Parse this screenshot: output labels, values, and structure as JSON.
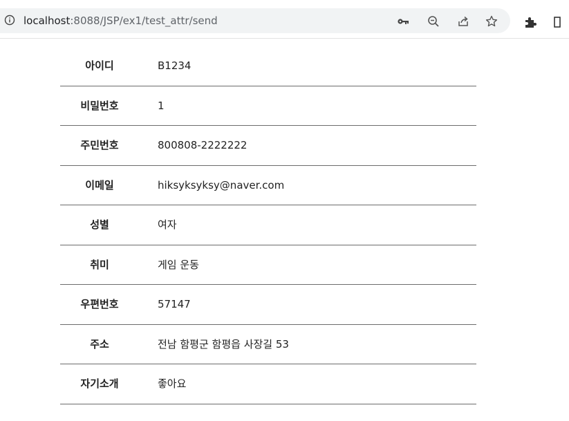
{
  "browser": {
    "url_host": "localhost",
    "url_path": ":8088/JSP/ex1/test_attr/send",
    "icons": [
      "info-icon",
      "key-icon",
      "zoom-icon",
      "share-icon",
      "star-icon",
      "extensions-icon"
    ]
  },
  "fields": [
    {
      "label": "아이디",
      "value": "B1234"
    },
    {
      "label": "비밀번호",
      "value": "1"
    },
    {
      "label": "주민번호",
      "value": "800808-2222222"
    },
    {
      "label": "이메일",
      "value": "hiksyksyksy@naver.com"
    },
    {
      "label": "성별",
      "value": "여자"
    },
    {
      "label": "취미",
      "value": "게임 운동"
    },
    {
      "label": "우편번호",
      "value": "57147"
    },
    {
      "label": "주소",
      "value": "전남 함평군 함평읍 사장길 53"
    },
    {
      "label": "자기소개",
      "value": "좋아요"
    }
  ]
}
